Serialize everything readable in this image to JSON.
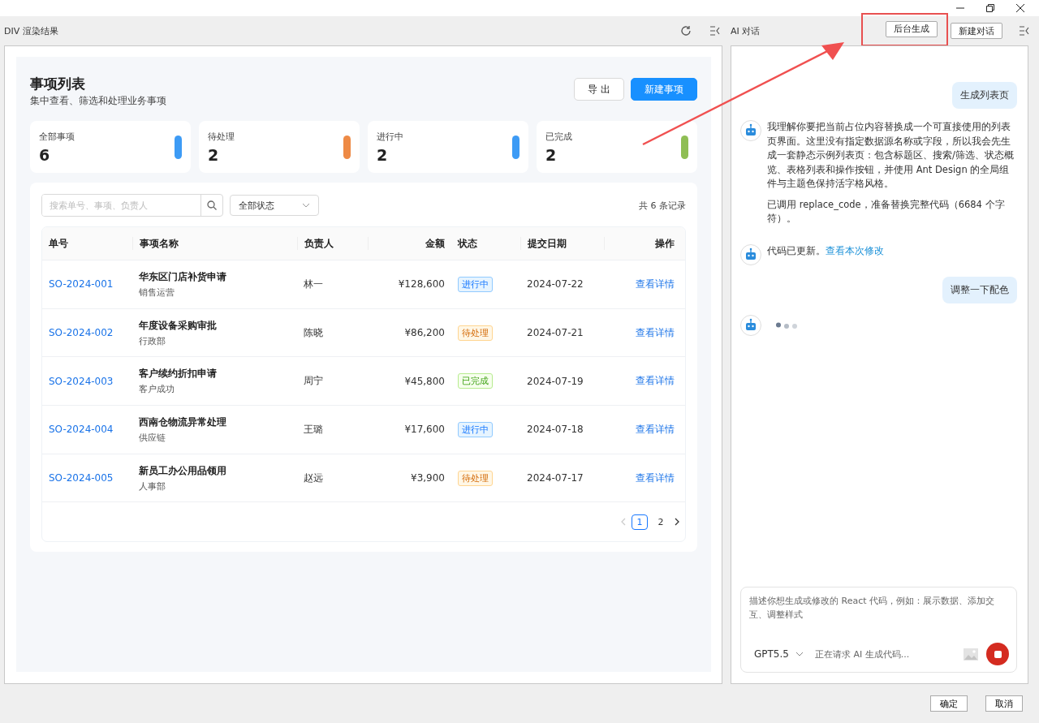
{
  "left_panel": {
    "title": "DIV 渲染结果"
  },
  "page": {
    "title": "事项列表",
    "subtitle": "集中查看、筛选和处理业务事项",
    "buttons": [
      {
        "label": "导 出",
        "kind": "default"
      },
      {
        "label": "新建事项",
        "kind": "primary"
      }
    ]
  },
  "stats": [
    {
      "label": "全部事项",
      "value": "6",
      "color": "#3d9bf5"
    },
    {
      "label": "待处理",
      "value": "2",
      "color": "#ee8a45"
    },
    {
      "label": "进行中",
      "value": "2",
      "color": "#3d9bf5"
    },
    {
      "label": "已完成",
      "value": "2",
      "color": "#8fbe54"
    }
  ],
  "filter": {
    "search_placeholder": "搜索单号、事项、负责人",
    "status_select": "全部状态",
    "total": "共 6 条记录"
  },
  "table": {
    "columns": [
      "单号",
      "事项名称",
      "负责人",
      "金额",
      "状态",
      "提交日期",
      "操作"
    ],
    "rows": [
      {
        "id": "SO-2024-001",
        "name": "华东区门店补货申请",
        "dept": "销售运营",
        "owner": "林一",
        "amount": "¥128,600",
        "status": {
          "label": "进行中",
          "kind": "processing"
        },
        "date": "2024-07-22",
        "action": "查看详情"
      },
      {
        "id": "SO-2024-002",
        "name": "年度设备采购审批",
        "dept": "行政部",
        "owner": "陈晓",
        "amount": "¥86,200",
        "status": {
          "label": "待处理",
          "kind": "pending"
        },
        "date": "2024-07-21",
        "action": "查看详情"
      },
      {
        "id": "SO-2024-003",
        "name": "客户续约折扣申请",
        "dept": "客户成功",
        "owner": "周宁",
        "amount": "¥45,800",
        "status": {
          "label": "已完成",
          "kind": "done"
        },
        "date": "2024-07-19",
        "action": "查看详情"
      },
      {
        "id": "SO-2024-004",
        "name": "西南仓物流异常处理",
        "dept": "供应链",
        "owner": "王璐",
        "amount": "¥17,600",
        "status": {
          "label": "进行中",
          "kind": "processing"
        },
        "date": "2024-07-18",
        "action": "查看详情"
      },
      {
        "id": "SO-2024-005",
        "name": "新员工办公用品领用",
        "dept": "人事部",
        "owner": "赵远",
        "amount": "¥3,900",
        "status": {
          "label": "待处理",
          "kind": "pending"
        },
        "date": "2024-07-17",
        "action": "查看详情"
      }
    ]
  },
  "pagination": {
    "prev_disabled": true,
    "pages": [
      {
        "label": "1",
        "selected": true
      },
      {
        "label": "2",
        "selected": false
      }
    ]
  },
  "chat": {
    "title": "AI 对话",
    "buttons": [
      "后台生成",
      "新建对话"
    ],
    "messages": [
      {
        "kind": "user",
        "text": "生成列表页"
      },
      {
        "kind": "assistant",
        "paragraphs": [
          "我理解你要把当前占位内容替换成一个可直接使用的列表页界面。这里没有指定数据源名称或字段，所以我会先生成一套静态示例列表页：包含标题区、搜索/筛选、状态概览、表格列表和操作按钮，并使用 Ant Design 的全局组件与主题色保持活字格风格。",
          "已调用 replace_code，准备替换完整代码（6684 个字符）。"
        ]
      },
      {
        "kind": "assistant",
        "paragraphs": [
          "代码已更新。"
        ],
        "link": "查看本次修改"
      },
      {
        "kind": "user",
        "text": "调整一下配色"
      },
      {
        "kind": "typing"
      }
    ],
    "input": {
      "placeholder": "描述你想生成或修改的 React 代码，例如：展示数据、添加交互、调整样式",
      "model": "GPT5.5",
      "status": "正在请求 AI 生成代码..."
    }
  },
  "footer": {
    "buttons": [
      "确定",
      "取消"
    ]
  }
}
